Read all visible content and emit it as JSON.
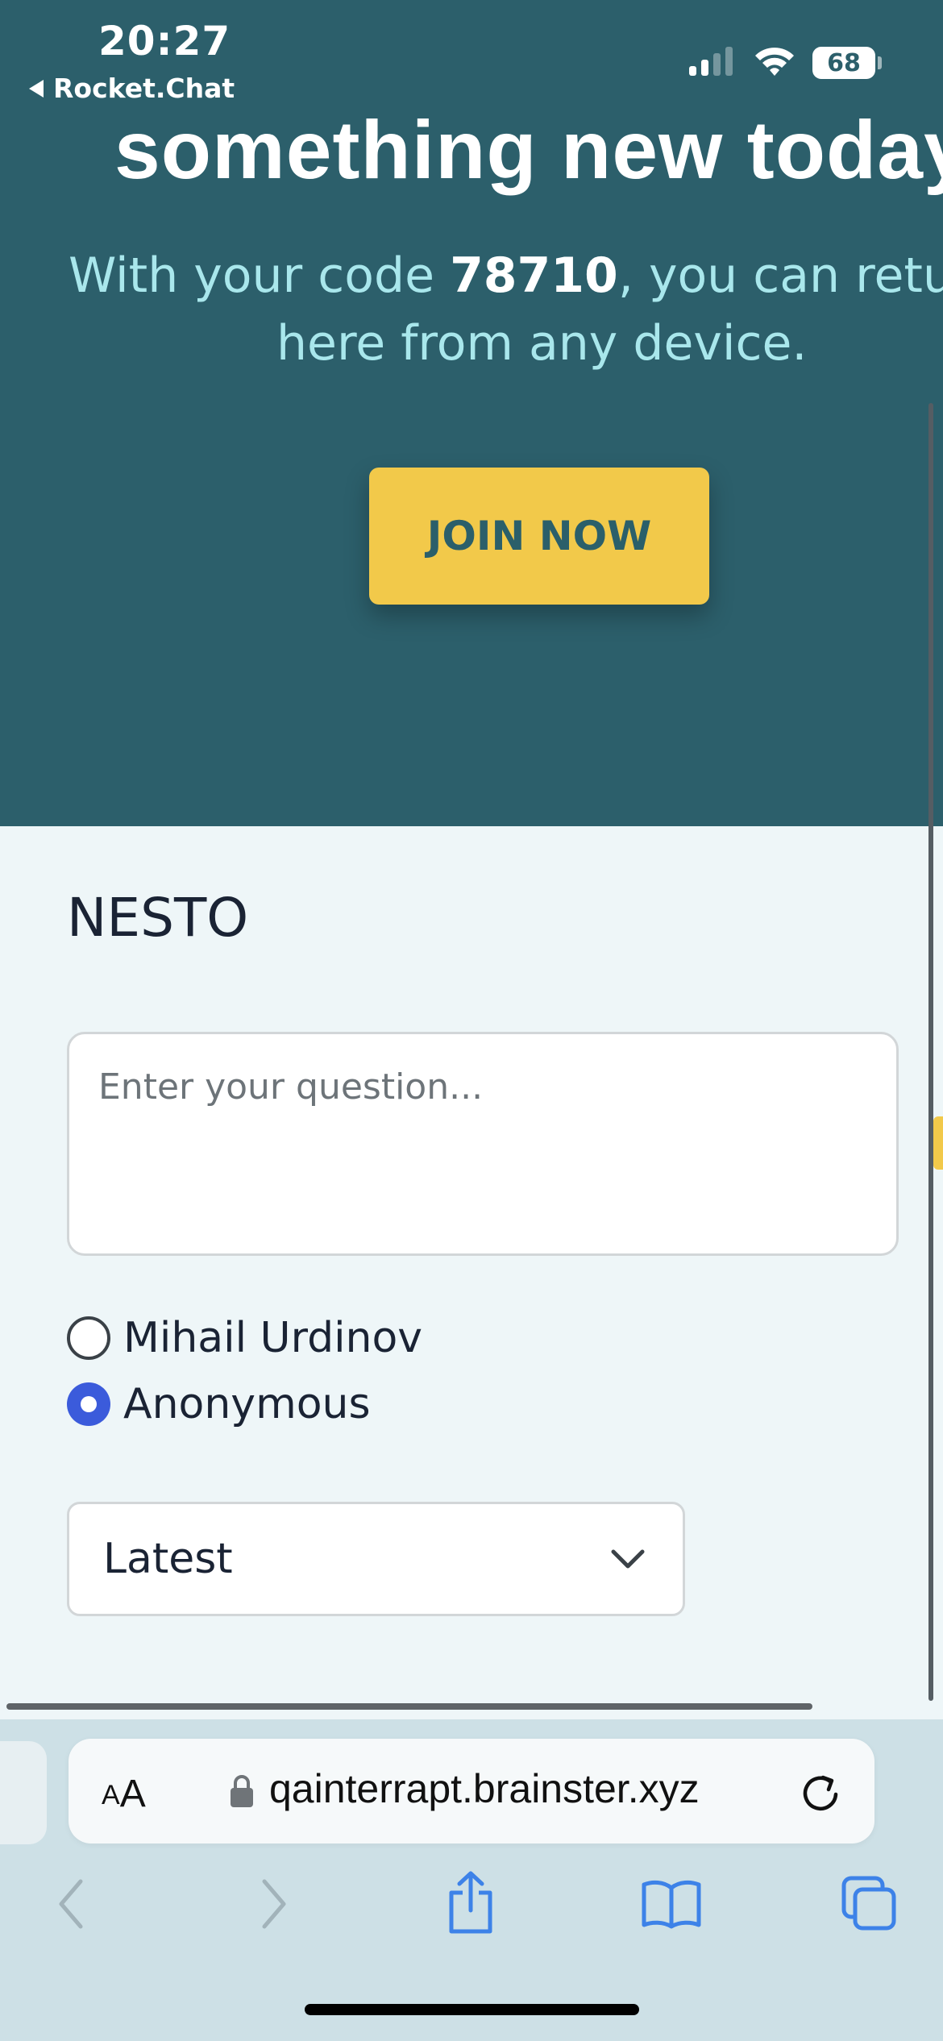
{
  "status_bar": {
    "time": "20:27",
    "back_app": "Rocket.Chat",
    "battery": "68"
  },
  "hero": {
    "title": "something new today",
    "subtitle_prefix": "With your code ",
    "code": "78710",
    "subtitle_suffix": ", you can retu",
    "subtitle_line2": "here from any device.",
    "join_button": "JOIN NOW"
  },
  "event": {
    "name": "NESTO"
  },
  "question": {
    "placeholder": "Enter your question..."
  },
  "identity": {
    "options": [
      {
        "label": "Mihail Urdinov",
        "selected": false
      },
      {
        "label": "Anonymous",
        "selected": true
      }
    ]
  },
  "sort": {
    "selected": "Latest"
  },
  "browser": {
    "text_size_small": "A",
    "text_size_big": "A",
    "url": "qainterrapt.brainster.xyz"
  },
  "colors": {
    "hero_background": "#2c5f6b",
    "accent_yellow": "#f2c94a",
    "radio_selected": "#3b5bdb",
    "browser_icon_blue": "#3d82e8"
  }
}
